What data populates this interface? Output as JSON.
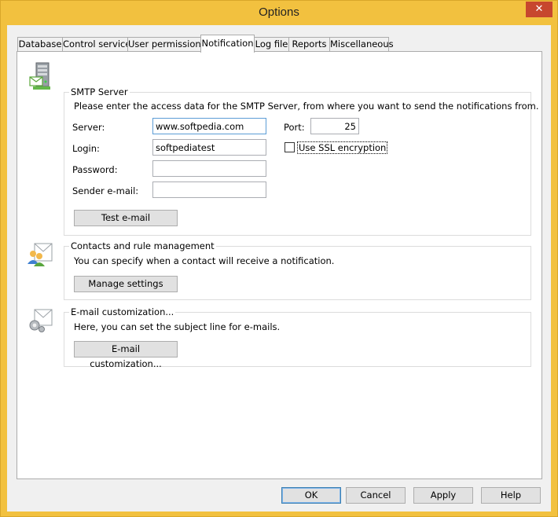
{
  "window": {
    "title": "Options",
    "close_glyph": "✕"
  },
  "tabs": [
    {
      "label": "Database"
    },
    {
      "label": "Control service"
    },
    {
      "label": "User permissions"
    },
    {
      "label": "Notification",
      "active": true
    },
    {
      "label": "Log file"
    },
    {
      "label": "Reports"
    },
    {
      "label": "Miscellaneous"
    }
  ],
  "smtp": {
    "group_title": "SMTP Server",
    "icon": "server-icon",
    "description": "Please enter the access data for the SMTP Server, from where you want to send the notifications from.",
    "server_label": "Server:",
    "server_value": "www.softpedia.com",
    "port_label": "Port:",
    "port_value": "25",
    "login_label": "Login:",
    "login_value": "softpediatest",
    "ssl_label": "Use SSL encryption",
    "ssl_checked": false,
    "password_label": "Password:",
    "password_value": "",
    "sender_label": "Sender e-mail:",
    "sender_value": "",
    "test_button": "Test e-mail"
  },
  "contacts": {
    "group_title": "Contacts and rule management",
    "icon": "contacts-mail-icon",
    "description": "You can specify when a contact will receive a notification.",
    "button": "Manage settings"
  },
  "email_custom": {
    "group_title": "E-mail customization...",
    "icon": "mail-settings-icon",
    "description": "Here, you can set the subject line for e-mails.",
    "button": "E-mail customization..."
  },
  "footer": {
    "ok": "OK",
    "cancel": "Cancel",
    "apply": "Apply",
    "help": "Help"
  },
  "colors": {
    "titlebar": "#f2c13f",
    "close": "#c7472e",
    "focus_border": "#5c9dd6"
  }
}
